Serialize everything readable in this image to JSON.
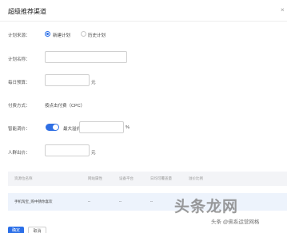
{
  "dialog": {
    "title": "超级推荐渠道",
    "close_glyph": "×"
  },
  "form": {
    "plan_source": {
      "label": "计划来源：",
      "options": [
        {
          "label": "新建计划",
          "selected": true
        },
        {
          "label": "历史计划",
          "selected": false
        }
      ]
    },
    "plan_name": {
      "label": "计划名称：",
      "value": ""
    },
    "daily_budget": {
      "label": "每日预算：",
      "value": "",
      "unit": "元"
    },
    "billing": {
      "label": "付费方式：",
      "value": "按点击付费（CPC）"
    },
    "smart_bid": {
      "label": "智能调价：",
      "enabled": true,
      "max_ratio_label": "最大溢价比例：",
      "max_ratio_value": "",
      "unit": "%"
    },
    "bid": {
      "label": "人群出价：",
      "value": "",
      "unit": "元"
    }
  },
  "table": {
    "headers": [
      "资源位名称",
      "网站属性",
      "设备平台",
      "日均可覆盖量",
      "溢价比例"
    ],
    "rows": [
      {
        "name": "手机淘宝_购中猜你喜欢",
        "site": "--",
        "device": "--",
        "coverage": "--"
      }
    ]
  },
  "buttons": {
    "confirm": "确定",
    "cancel": "取消"
  },
  "watermark": {
    "logo": "头条龙网",
    "line": "头条 @佛系运营网格"
  },
  "colors": {
    "accent": "#2b6fe8",
    "header_bg": "#f3f4f7",
    "row_bg": "#edf3fc"
  },
  "icons": {
    "close": "close-icon"
  }
}
